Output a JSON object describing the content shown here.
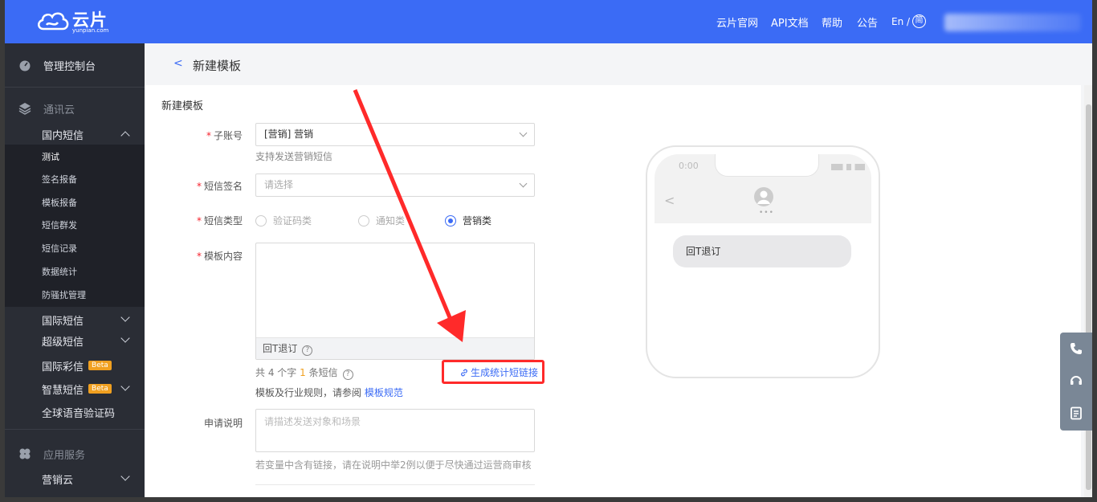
{
  "header": {
    "logo_text": "云片",
    "logo_sub": "yunpian.com",
    "nav": [
      "云片官网",
      "API文档",
      "帮助",
      "公告"
    ],
    "lang_en": "En /",
    "lang_cn": "简"
  },
  "sidebar": {
    "console": "管理控制台",
    "group_comm": "通讯云",
    "domestic_sms": "国内短信",
    "domestic_items": [
      "测试",
      "签名报备",
      "模板报备",
      "短信群发",
      "短信记录",
      "数据统计",
      "防骚扰管理"
    ],
    "intl_sms": "国际短信",
    "super_sms": "超级短信",
    "intl_mms": "国际彩信",
    "smart_sms": "智慧短信",
    "beta": "Beta",
    "voice_code": "全球语音验证码",
    "group_app": "应用服务",
    "marketing_cloud": "营销云"
  },
  "page": {
    "back": "<",
    "title": "新建模板",
    "section_title": "新建模板"
  },
  "form": {
    "sub_account_label": "子账号",
    "sub_account_value": "[营销] 营销",
    "sub_account_hint": "支持发送营销短信",
    "signature_label": "短信签名",
    "signature_placeholder": "请选择",
    "type_label": "短信类型",
    "type_options": [
      "验证码类",
      "通知类",
      "营销类"
    ],
    "content_label": "模板内容",
    "unsubscribe": "回T退订",
    "count_prefix": "共 4 个字",
    "count_num": "1",
    "count_suffix": "条短信",
    "gen_link": "生成统计短链接",
    "rules_text": "模板及行业规则，请参阅",
    "rules_link": "模板规范",
    "desc_label": "申请说明",
    "desc_placeholder": "请描述发送对象和场景",
    "desc_hint": "若变量中含有链接，请在说明中举2例以便于尽快通过运营商审核",
    "help_mark": "?"
  },
  "phone": {
    "time": "0:00",
    "message": "回T退订"
  },
  "colors": {
    "brand": "#3b6bf5",
    "highlight": "#ff2a2a",
    "sidebar_bg": "#2a2d35"
  }
}
